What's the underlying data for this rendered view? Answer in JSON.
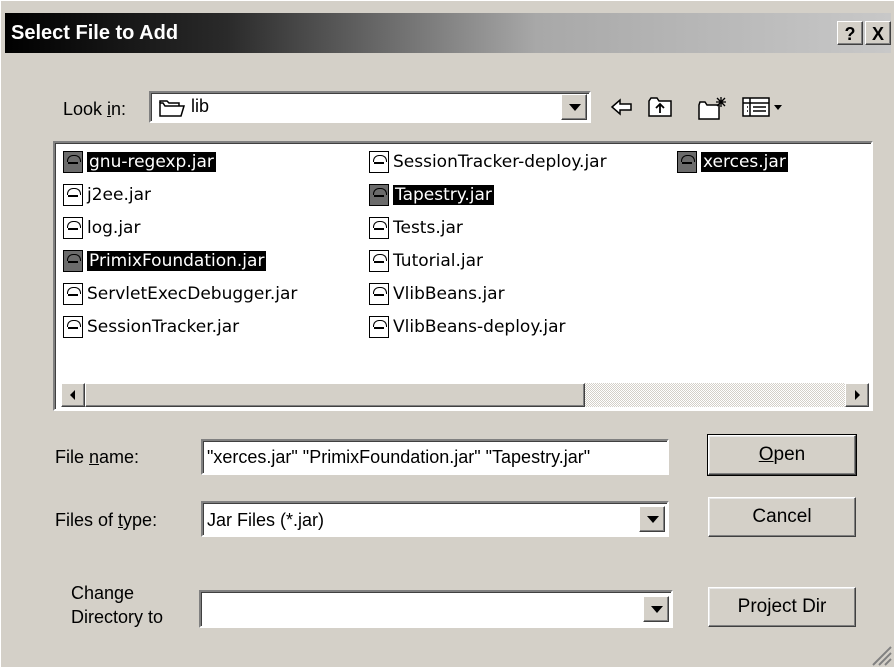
{
  "dialog": {
    "title": "Select File to Add",
    "help_label": "?",
    "close_label": "X"
  },
  "look_in": {
    "label_pre": "Look ",
    "label_u": "i",
    "label_post": "n:",
    "value": "lib"
  },
  "files": {
    "col1": [
      {
        "name": "gnu-regexp.jar",
        "selected": true
      },
      {
        "name": "j2ee.jar",
        "selected": false
      },
      {
        "name": "log.jar",
        "selected": false
      },
      {
        "name": "PrimixFoundation.jar",
        "selected": true
      },
      {
        "name": "ServletExecDebugger.jar",
        "selected": false
      },
      {
        "name": "SessionTracker.jar",
        "selected": false
      }
    ],
    "col2": [
      {
        "name": "SessionTracker-deploy.jar",
        "selected": false
      },
      {
        "name": "Tapestry.jar",
        "selected": true
      },
      {
        "name": "Tests.jar",
        "selected": false
      },
      {
        "name": "Tutorial.jar",
        "selected": false
      },
      {
        "name": "VlibBeans.jar",
        "selected": false
      },
      {
        "name": "VlibBeans-deploy.jar",
        "selected": false
      }
    ],
    "col3": [
      {
        "name": "xerces.jar",
        "selected": true
      }
    ]
  },
  "file_name": {
    "label_pre": "File ",
    "label_u": "n",
    "label_post": "ame:",
    "value": "\"xerces.jar\" \"PrimixFoundation.jar\" \"Tapestry.jar\""
  },
  "file_type": {
    "label_pre": "Files of ",
    "label_u": "t",
    "label_post": "ype:",
    "value": "Jar Files (*.jar)"
  },
  "change_dir": {
    "label_line1": "Change",
    "label_line2": "Directory to",
    "value": ""
  },
  "buttons": {
    "open_u": "O",
    "open_rest": "pen",
    "cancel": "Cancel",
    "project_dir": "Project Dir"
  },
  "icons": {
    "folder": "folder-icon",
    "back": "back-arrow-icon",
    "up": "up-folder-icon",
    "new_folder": "new-folder-icon",
    "view": "view-menu-icon",
    "file": "jar-file-icon"
  }
}
